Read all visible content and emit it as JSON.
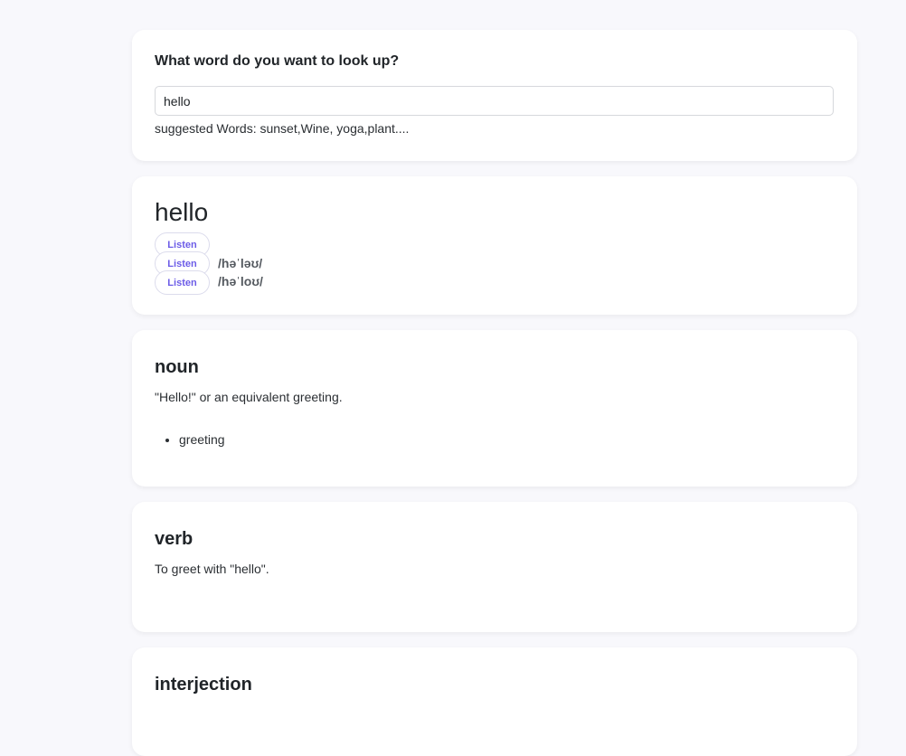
{
  "search": {
    "question": "What word do you want to look up?",
    "value": "hello",
    "suggestions": "suggested Words: sunset,Wine, yoga,plant...."
  },
  "word": {
    "title": "hello",
    "listen_label": "Listen",
    "phonetics": [
      "/həˈləʊ/",
      "/həˈloʊ/"
    ]
  },
  "meanings": [
    {
      "part_of_speech": "noun",
      "definition": "\"Hello!\" or an equivalent greeting.",
      "synonyms": [
        "greeting"
      ]
    },
    {
      "part_of_speech": "verb",
      "definition": "To greet with \"hello\"."
    },
    {
      "part_of_speech": "interjection"
    }
  ],
  "colors": {
    "accent": "#6c5ce7",
    "background": "#f8f8fc",
    "card": "#ffffff"
  }
}
